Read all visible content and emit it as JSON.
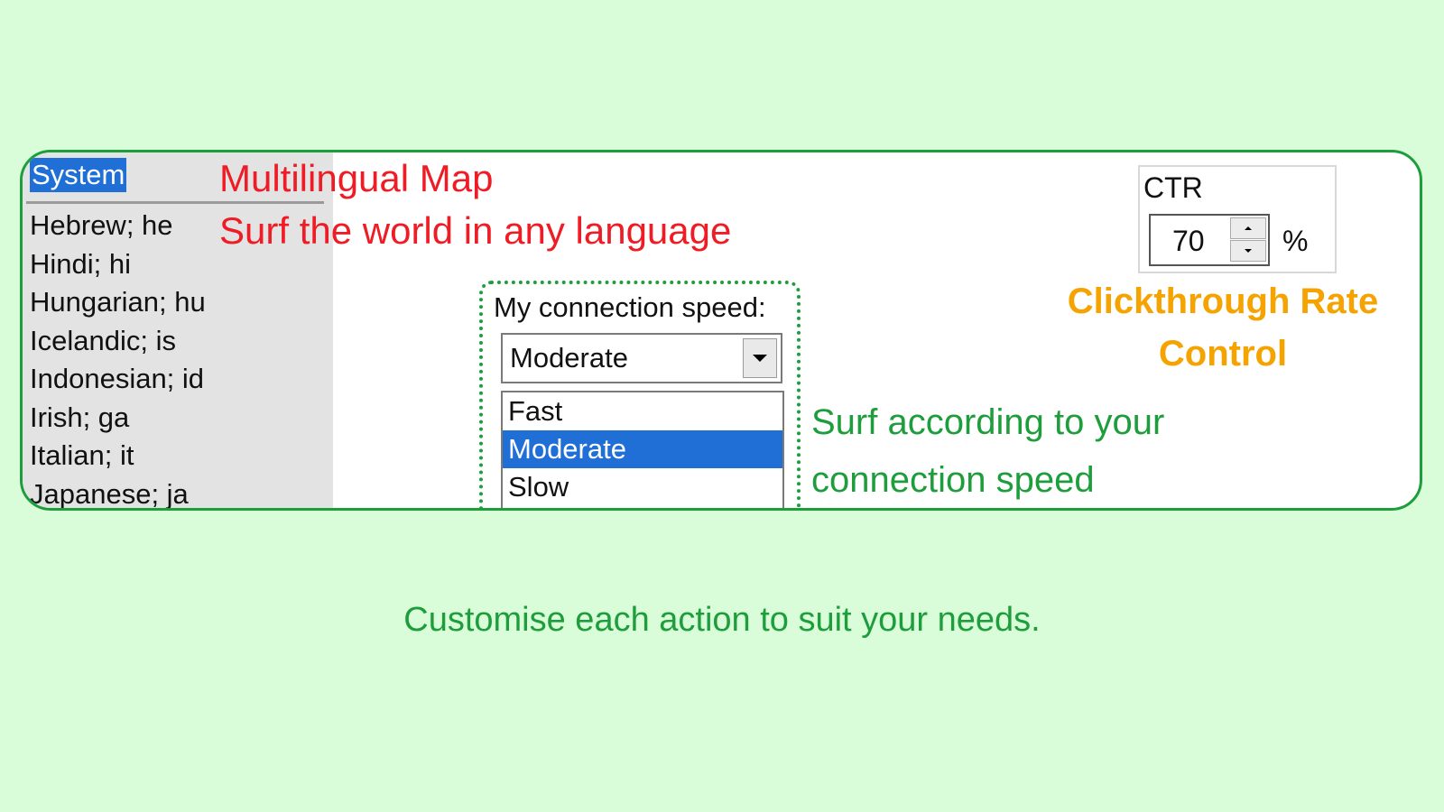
{
  "language_list": {
    "header": "System",
    "items": [
      "Hebrew; he",
      "Hindi; hi",
      "Hungarian; hu",
      "Icelandic; is",
      "Indonesian; id",
      "Irish; ga",
      "Italian; it",
      "Japanese; ja"
    ]
  },
  "multilingual": {
    "title": "Multilingual Map",
    "subtitle": "Surf the world in any language"
  },
  "connection_speed": {
    "label": "My connection speed:",
    "selected": "Moderate",
    "options": [
      "Fast",
      "Moderate",
      "Slow"
    ],
    "description_line1": "Surf according to your",
    "description_line2": "connection speed"
  },
  "ctr": {
    "label": "CTR",
    "value": "70",
    "unit": "%",
    "description_line1": "Clickthrough Rate",
    "description_line2": "Control"
  },
  "caption": "Customise each action to suit your needs.",
  "colors": {
    "background": "#d9fdd8",
    "accent_green": "#1e9d3c",
    "title_red": "#ee1c25",
    "ctr_orange": "#f5a300",
    "selection_blue": "#1f6fd6"
  }
}
